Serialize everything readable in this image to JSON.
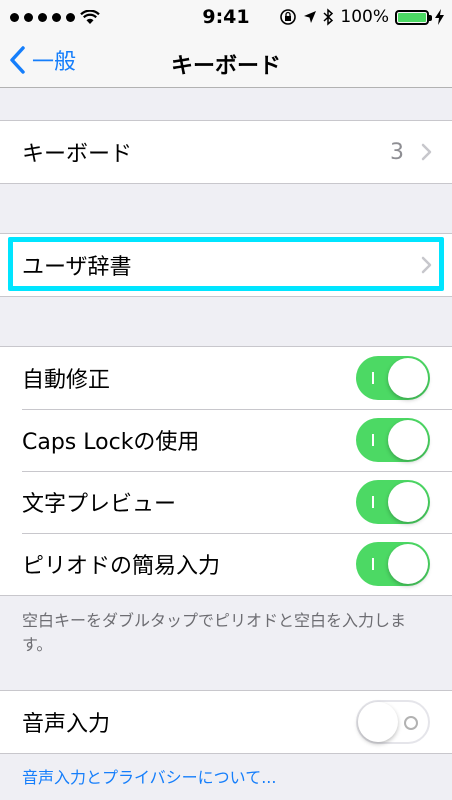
{
  "status_bar": {
    "time": "9:41",
    "battery": "100%"
  },
  "nav": {
    "back_label": "一般",
    "title": "キーボード"
  },
  "keyboards": {
    "label": "キーボード",
    "value": "3"
  },
  "user_dictionary": {
    "label": "ユーザ辞書"
  },
  "toggles": [
    {
      "label": "自動修正",
      "on": true
    },
    {
      "label": "Caps Lockの使用",
      "on": true
    },
    {
      "label": "文字プレビュー",
      "on": true
    },
    {
      "label": "ピリオドの簡易入力",
      "on": true
    }
  ],
  "period_footnote": "空白キーをダブルタップでピリオドと空白を入力します。",
  "dictation": {
    "label": "音声入力",
    "on": false
  },
  "dictation_link": "音声入力とプライバシーについて...",
  "colors": {
    "accent": "#157efb",
    "toggle_on": "#4cd964",
    "highlight": "#00e5ff"
  }
}
